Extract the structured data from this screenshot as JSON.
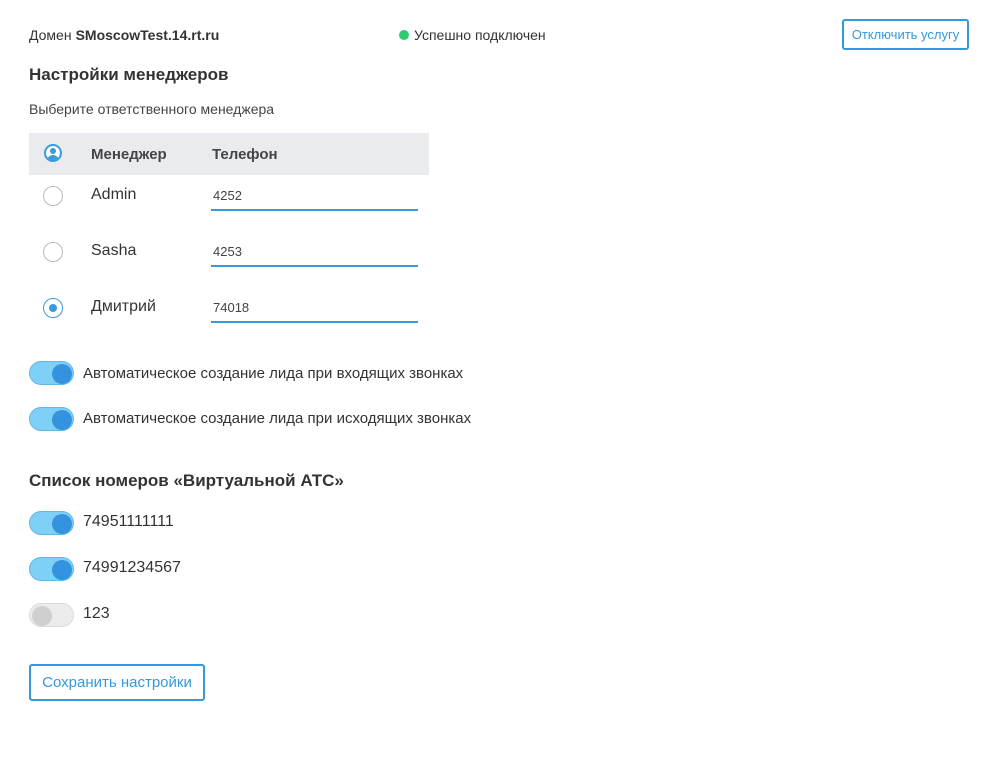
{
  "header": {
    "domain_label": "Домен",
    "domain_value": "SMoscowTest.14.rt.ru",
    "status_text": "Успешно подключен",
    "status_color": "#2ecc71",
    "disconnect_label": "Отключить услугу"
  },
  "managers_section": {
    "title": "Настройки менеджеров",
    "subtitle": "Выберите ответственного менеджера",
    "columns": {
      "icon": "user-circle-icon",
      "manager": "Менеджер",
      "phone": "Телефон"
    },
    "rows": [
      {
        "name": "Admin",
        "phone": "4252",
        "selected": false
      },
      {
        "name": "Sasha",
        "phone": "4253",
        "selected": false
      },
      {
        "name": "Дмитрий",
        "phone": "74018",
        "selected": true
      }
    ]
  },
  "lead_toggles": [
    {
      "label": "Автоматическое создание лида при входящих звонках",
      "on": true
    },
    {
      "label": "Автоматическое создание лида при исходящих звонках",
      "on": true
    }
  ],
  "numbers_section": {
    "title": "Список номеров «Виртуальной АТС»",
    "numbers": [
      {
        "label": "74951111111",
        "on": true
      },
      {
        "label": "74991234567",
        "on": true
      },
      {
        "label": "123",
        "on": false
      }
    ]
  },
  "save_label": "Сохранить настройки",
  "colors": {
    "accent": "#3a9bdc",
    "toggle_on": "#7fd0f6",
    "knob_on": "#3592de"
  }
}
